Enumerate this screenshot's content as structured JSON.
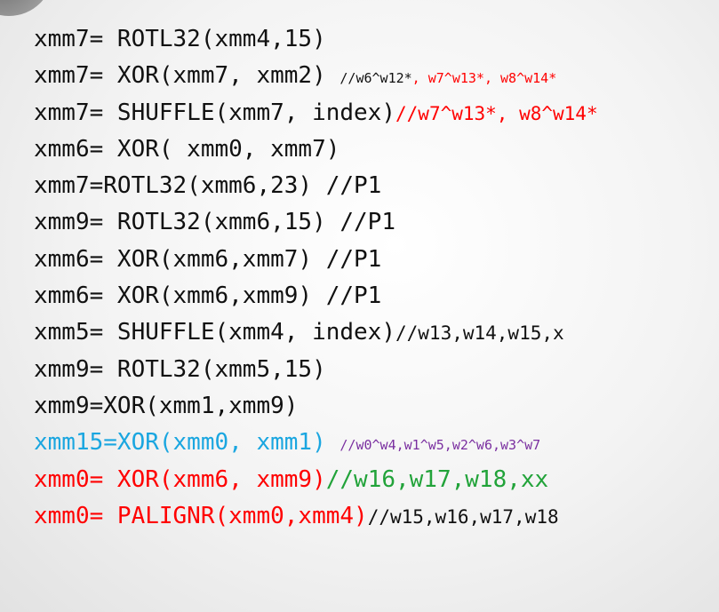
{
  "colors": {
    "text": "#111111",
    "red": "#ff0000",
    "blue": "#1aa6e0",
    "green": "#22a33a",
    "purple": "#7a2fa0"
  },
  "lines": [
    {
      "code": "xmm7= ROTL32(xmm4,15)"
    },
    {
      "code": "xmm7= XOR(xmm7,  xmm2)",
      "comment_prefix": "//w6^w12*",
      "comment_red": ", w7^w13*, w8^w14*"
    },
    {
      "code": "xmm7= SHUFFLE(xmm7, index)",
      "comment_prefix": "//",
      "comment_red": "w7^w13*, w8^w14*"
    },
    {
      "code": "xmm6= XOR( xmm0,  xmm7)"
    },
    {
      "code": "xmm7=ROTL32(xmm6,23)    //P1"
    },
    {
      "code": "xmm9= ROTL32(xmm6,15)   //P1"
    },
    {
      "code": "xmm6= XOR(xmm6,xmm7)    //P1"
    },
    {
      "code": "xmm6= XOR(xmm6,xmm9)    //P1"
    },
    {
      "code": "xmm5= SHUFFLE(xmm4, index)",
      "comment": "//w13,w14,w15,x"
    },
    {
      "code": "xmm9= ROTL32(xmm5,15)"
    },
    {
      "code": "xmm9=XOR(xmm1,xmm9)"
    },
    {
      "code": "xmm15=XOR(xmm0,  xmm1)",
      "comment": "//w0^w4,w1^w5,w2^w6,w3^w7"
    },
    {
      "code": "xmm0= XOR(xmm6,  xmm9)",
      "comment": "//w16,w17,w18,xx"
    },
    {
      "code": "xmm0= PALIGNR(xmm0,xmm4)",
      "comment": "//w15,w16,w17,w18"
    }
  ]
}
